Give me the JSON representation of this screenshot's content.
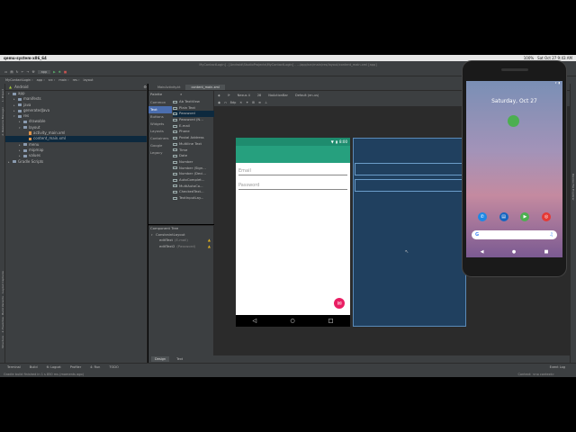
{
  "mac_bar": {
    "app": "qemu-system-x86_64",
    "battery": "100%",
    "datetime": "Sat Oct 27  9:43 AM"
  },
  "title": "MyContactLogin] - [Android\\StudioProjects\\MyContactLogin] - .../app/src/main/res/layout/content_main.xml [app]",
  "toolbar": {
    "config": "app"
  },
  "breadcrumb": [
    "MyContactLogin",
    "app",
    "src",
    "main",
    "res",
    "layout"
  ],
  "project": {
    "view": "Android",
    "tree": [
      {
        "label": "app",
        "indent": 0,
        "kind": "folder",
        "open": true
      },
      {
        "label": "manifests",
        "indent": 1,
        "kind": "folder"
      },
      {
        "label": "java",
        "indent": 1,
        "kind": "folder"
      },
      {
        "label": "generatedJava",
        "indent": 1,
        "kind": "folder"
      },
      {
        "label": "res",
        "indent": 1,
        "kind": "folder",
        "open": true
      },
      {
        "label": "drawable",
        "indent": 2,
        "kind": "folder"
      },
      {
        "label": "layout",
        "indent": 2,
        "kind": "folder",
        "open": true
      },
      {
        "label": "activity_main.xml",
        "indent": 3,
        "kind": "xml"
      },
      {
        "label": "content_main.xml",
        "indent": 3,
        "kind": "xml",
        "selected": true
      },
      {
        "label": "menu",
        "indent": 2,
        "kind": "folder"
      },
      {
        "label": "mipmap",
        "indent": 2,
        "kind": "folder"
      },
      {
        "label": "values",
        "indent": 2,
        "kind": "folder"
      },
      {
        "label": "Gradle Scripts",
        "indent": 0,
        "kind": "gradle"
      }
    ]
  },
  "left_tools": [
    "1: Project",
    "2: Resource Manager"
  ],
  "left_tools_lower": [
    "Layout Captures",
    "Build Variants",
    "2: Favorites",
    "Structure"
  ],
  "editor_tabs": [
    {
      "label": "MainActivity.kt",
      "active": false
    },
    {
      "label": "content_main.xml",
      "active": true
    }
  ],
  "palette": {
    "title": "Palette",
    "categories": [
      {
        "label": "Common",
        "selected": false
      },
      {
        "label": "Text",
        "selected": true
      },
      {
        "label": "Buttons",
        "selected": false
      },
      {
        "label": "Widgets",
        "selected": false
      },
      {
        "label": "Layouts",
        "selected": false
      },
      {
        "label": "Containers",
        "selected": false
      },
      {
        "label": "Google",
        "selected": false
      },
      {
        "label": "Legacy",
        "selected": false
      }
    ],
    "items": [
      {
        "label": "Ab TextView",
        "selected": false
      },
      {
        "label": "Plain Text",
        "selected": false
      },
      {
        "label": "Password",
        "selected": true
      },
      {
        "label": "Password (N...",
        "selected": false
      },
      {
        "label": "E-mail",
        "selected": false
      },
      {
        "label": "Phone",
        "selected": false
      },
      {
        "label": "Postal Address",
        "selected": false
      },
      {
        "label": "Multiline Text",
        "selected": false
      },
      {
        "label": "Time",
        "selected": false
      },
      {
        "label": "Date",
        "selected": false
      },
      {
        "label": "Number",
        "selected": false
      },
      {
        "label": "Number (Sign...",
        "selected": false
      },
      {
        "label": "Number (Deci...",
        "selected": false
      },
      {
        "label": "AutoComplet...",
        "selected": false
      },
      {
        "label": "MultiAutoCo...",
        "selected": false
      },
      {
        "label": "CheckedText...",
        "selected": false
      },
      {
        "label": "TextInputLay...",
        "selected": false
      }
    ]
  },
  "component_tree": {
    "title": "Component Tree",
    "root": "ConstraintLayout",
    "children": [
      {
        "label": "editText",
        "hint": "(E-mail)"
      },
      {
        "label": "editText2",
        "hint": "(Password)"
      }
    ]
  },
  "canvas_bar": {
    "device": "Nexus 4",
    "api": "28",
    "theme": "NoActionBar",
    "locale": "Default (en-us)",
    "zoom": "25%",
    "margin": "8dp"
  },
  "design_phone": {
    "time": "8:00",
    "email_hint": "Email",
    "password_hint": "Password",
    "brand_color": "#26a07e",
    "fab_color": "#e91e63"
  },
  "bottom_tabs": [
    {
      "label": "Design",
      "active": true
    },
    {
      "label": "Text",
      "active": false
    }
  ],
  "bottom_tools": [
    "Terminal",
    "Build",
    "6: Logcat",
    "Profiler",
    "4: Run",
    "TODO"
  ],
  "event_log": "Event Log",
  "status": {
    "message": "Gradle build finished in 1 s 850 ms (moments ago)",
    "right": "Context: <no context>"
  },
  "right_tools": [
    "Device File Explorer"
  ],
  "emulator": {
    "date": "Saturday, Oct 27",
    "dock_colors": [
      "#1e88e5",
      "#1565c0",
      "#4caf50",
      "#e53935"
    ],
    "search_letter": "G"
  }
}
